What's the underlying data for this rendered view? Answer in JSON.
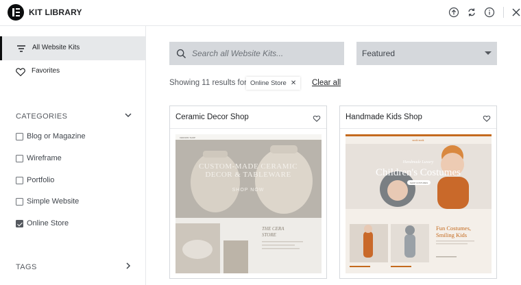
{
  "header": {
    "title": "KIT LIBRARY"
  },
  "sidebar": {
    "nav": [
      {
        "label": "All Website Kits",
        "icon": "filter-lines-icon",
        "active": true
      },
      {
        "label": "Favorites",
        "icon": "heart-icon",
        "active": false
      }
    ],
    "categories_label": "CATEGORIES",
    "categories": [
      {
        "label": "Blog or Magazine",
        "checked": false
      },
      {
        "label": "Wireframe",
        "checked": false
      },
      {
        "label": "Portfolio",
        "checked": false
      },
      {
        "label": "Simple Website",
        "checked": false
      },
      {
        "label": "Online Store",
        "checked": true
      }
    ],
    "tags_label": "TAGS"
  },
  "main": {
    "search_placeholder": "Search all Website Kits...",
    "sort_value": "Featured",
    "results_text": "Showing 11 results for",
    "filter_chip": "Online Store",
    "clear_all": "Clear all",
    "kits": [
      {
        "title": "Ceramic Decor Shop",
        "preview": {
          "brand": "CERAMIC SHOP",
          "headline_1": "CUSTOM-MADE CERAMIC",
          "headline_2": "DECOR & TABLEWARE",
          "cta": "SHOP NOW",
          "section_1": "THE CERA",
          "section_2": "STORE"
        }
      },
      {
        "title": "Handmade Kids Shop",
        "preview": {
          "brand": "nook nook",
          "tagline": "Handmade Luxury",
          "headline": "Children's Costumes",
          "cta": "SHOP COSTUMES",
          "promo_1": "Fun Costumes,",
          "promo_2": "Smiling Kids"
        }
      }
    ]
  },
  "colors": {
    "accent_orange": "#c46a1e",
    "sidebar_active": "#e6e8ea",
    "input_bg": "#d5d8dc"
  }
}
